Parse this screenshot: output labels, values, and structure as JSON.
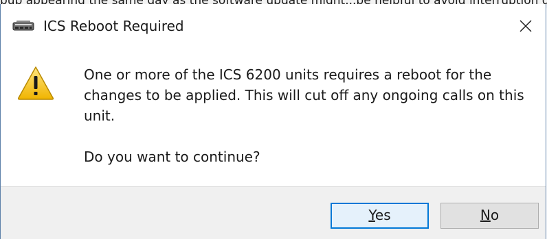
{
  "background_window": {
    "partial_text": "pup appearing the same day as the software update might...be helpful to avoid interruption during ..."
  },
  "dialog": {
    "title": "ICS Reboot Required",
    "app_icon": "ics-device-icon",
    "close_icon": "close-icon",
    "message_line": "One or more of the ICS 6200 units requires a reboot for the changes to be applied. This will cut off any ongoing calls on this unit.",
    "question": "Do you want to continue?",
    "warning_icon": "warning-icon",
    "buttons": {
      "yes_label": "Yes",
      "yes_mnemonic": "Y",
      "yes_rest": "es",
      "no_label": "No",
      "no_mnemonic": "N",
      "no_rest": "o"
    },
    "colors": {
      "accent": "#0078d7",
      "warning_fill": "#f5c518",
      "border": "#5b7fa8"
    }
  }
}
